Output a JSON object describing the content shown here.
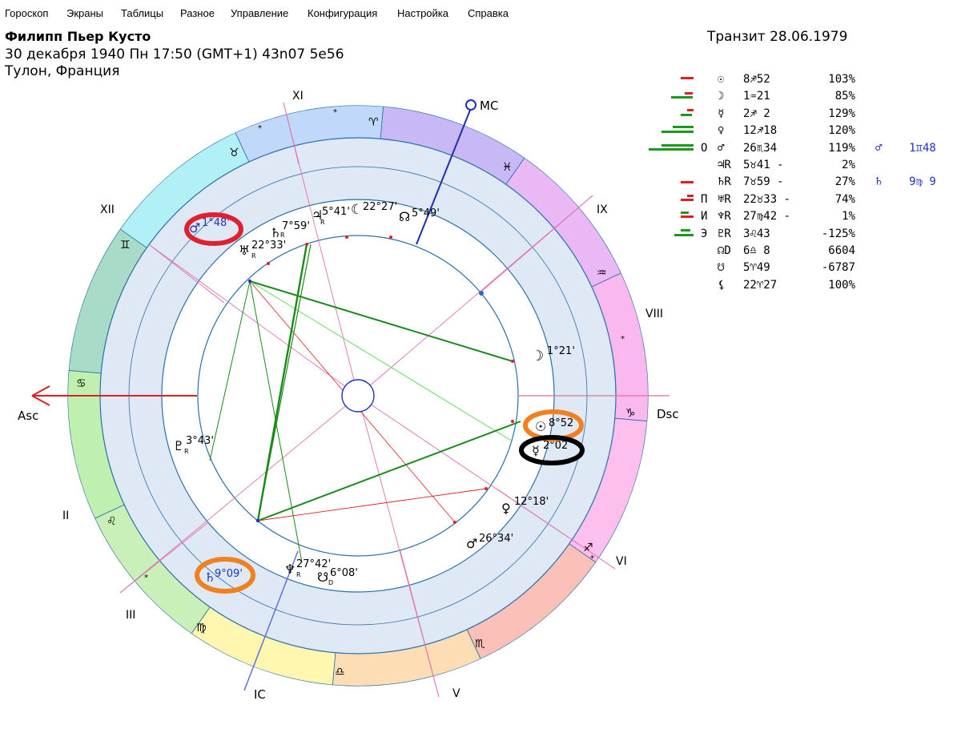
{
  "menu": [
    "Гороскоп",
    "Экраны",
    "Таблицы",
    "Разное",
    "Управление",
    "Конфигурация",
    "Настройка",
    "Справка"
  ],
  "header": {
    "name": "Филипп Пьер Кусто",
    "date_line": "30 декабря 1940  Пн  17:50 (GMT+1) 43n07  5e56",
    "place": "Тулон, Франция",
    "transit": "Транзит 28.06.1979"
  },
  "chart": {
    "axes": {
      "asc": "Asc",
      "dsc": "Dsc",
      "mc": "MC",
      "ic": "IC"
    },
    "houses": [
      "II",
      "III",
      "V",
      "VI",
      "VIII",
      "IX",
      "XI",
      "XII"
    ],
    "signs": [
      "♋",
      "♊",
      "♉",
      "♈",
      "♓",
      "♒",
      "♑",
      "♐",
      "♏",
      "♎",
      "♍",
      "♌"
    ],
    "transit_planets": [
      {
        "glyph": "♂",
        "label": "1°48'",
        "color": "#2030c0"
      },
      {
        "glyph": "♄",
        "label": "7°59'",
        "sub": "R",
        "color": "#000000"
      },
      {
        "glyph": "♅",
        "label": "22°33'",
        "sub": "R",
        "color": "#000000"
      },
      {
        "glyph": "♃",
        "label": "5°41'",
        "sub": "R",
        "color": "#000000"
      },
      {
        "glyph": "☾",
        "label": "22°27'",
        "color": "#000000"
      },
      {
        "glyph": "☊",
        "label": "5°49'",
        "color": "#000000"
      },
      {
        "glyph": "☽",
        "label": "1°21'",
        "color": "#000000"
      },
      {
        "glyph": "☉",
        "label": "8°52",
        "color": "#000000"
      },
      {
        "glyph": "☿",
        "label": "2°02",
        "color": "#000000"
      },
      {
        "glyph": "♀",
        "label": "12°18'",
        "color": "#000000"
      },
      {
        "glyph": "♂",
        "label": "26°34'",
        "color": "#000000"
      },
      {
        "glyph": "♆",
        "label": "27°42'",
        "sub": "R",
        "color": "#000000"
      },
      {
        "glyph": "☋",
        "label": "6°08'",
        "sub": "D",
        "color": "#000000"
      },
      {
        "glyph": "♄",
        "label": "9°09'",
        "color": "#2030c0"
      },
      {
        "glyph": "♇",
        "label": "3°43'",
        "sub": "R",
        "color": "#000000"
      }
    ]
  },
  "table": {
    "rows": [
      {
        "prefix": "",
        "glyph": "☉",
        "value": "8♐52",
        "pct": "103%",
        "extra": ""
      },
      {
        "prefix": "",
        "glyph": "☽",
        "value": "1♒21",
        "pct": "85%",
        "extra": ""
      },
      {
        "prefix": "",
        "glyph": "☿",
        "value": "2♐ 2",
        "pct": "129%",
        "extra": ""
      },
      {
        "prefix": "",
        "glyph": "♀",
        "value": "12♐18",
        "pct": "120%",
        "extra": ""
      },
      {
        "prefix": "О",
        "glyph": "♂",
        "value": "26♏34",
        "pct": "119%",
        "extra": "♂    1♊48"
      },
      {
        "prefix": "",
        "glyph": "♃R",
        "value": "5♉41 -",
        "pct": "2%",
        "extra": ""
      },
      {
        "prefix": "",
        "glyph": "♄R",
        "value": "7♉59 -",
        "pct": "27%",
        "extra": "♄    9♍ 9"
      },
      {
        "prefix": "П",
        "glyph": "♅R",
        "value": "22♉33 -",
        "pct": "74%",
        "extra": ""
      },
      {
        "prefix": "И",
        "glyph": "♆R",
        "value": "27♍42 -",
        "pct": "1%",
        "extra": ""
      },
      {
        "prefix": "Э",
        "glyph": "♇R",
        "value": "3♌43",
        "pct": "-125%",
        "extra": ""
      },
      {
        "prefix": "",
        "glyph": "☊D",
        "value": "6♎ 8",
        "pct": "6604",
        "extra": ""
      },
      {
        "prefix": "",
        "glyph": "☋",
        "value": "5♈49",
        "pct": "-6787",
        "extra": ""
      },
      {
        "prefix": "",
        "glyph": "⚸",
        "value": "22♈27",
        "pct": "100%",
        "extra": ""
      }
    ]
  },
  "colors": {
    "inner_ring": "#dfe8f5",
    "red_bar": "#e02020",
    "green_bar": "#1a9a1a",
    "highlight_red": "#e02030",
    "highlight_orange": "#f08020",
    "highlight_black": "#000000"
  }
}
